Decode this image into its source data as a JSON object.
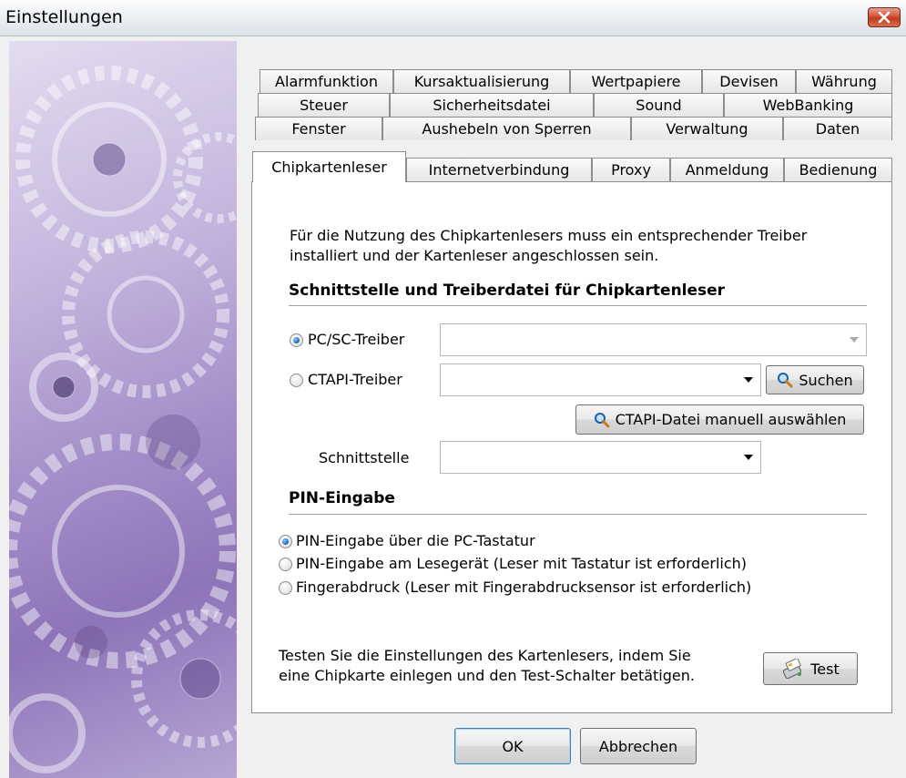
{
  "window": {
    "title": "Einstellungen"
  },
  "tabs": {
    "row1": [
      "Alarmfunktion",
      "Kursaktualisierung",
      "Wertpapiere",
      "Devisen",
      "Währung"
    ],
    "row2": [
      "Steuer",
      "Sicherheitsdatei",
      "Sound",
      "WebBanking"
    ],
    "row3": [
      "Fenster",
      "Aushebeln von Sperren",
      "Verwaltung",
      "Daten"
    ],
    "row4": [
      "Chipkartenleser",
      "Internetverbindung",
      "Proxy",
      "Anmeldung",
      "Bedienung"
    ],
    "active": "Chipkartenleser"
  },
  "panel": {
    "intro_line1": "Für die Nutzung des Chipkartenlesers muss ein entsprechender Treiber",
    "intro_line2": "installiert und der Kartenleser angeschlossen sein.",
    "section1_title": "Schnittstelle und Treiberdatei für Chipkartenleser",
    "pcsc_label": "PC/SC-Treiber",
    "ctapi_label": "CTAPI-Treiber",
    "search_button": "Suchen",
    "ctapi_manual_button": "CTAPI-Datei manuell auswählen",
    "interface_label": "Schnittstelle",
    "section2_title": "PIN-Eingabe",
    "pin_options": [
      "PIN-Eingabe über die PC-Tastatur",
      "PIN-Eingabe am Lesegerät (Leser mit Tastatur ist erforderlich)",
      "Fingerabdruck (Leser mit Fingerabdrucksensor ist erforderlich)"
    ],
    "test_line1": "Testen Sie die Einstellungen des Kartenlesers, indem Sie",
    "test_line2": "eine Chipkarte einlegen und den Test-Schalter betätigen.",
    "test_button": "Test"
  },
  "footer": {
    "ok_button": "OK",
    "cancel_button": "Abbrechen"
  },
  "icons": {
    "close": "close-icon",
    "search": "magnifier-icon",
    "test": "card-reader-icon"
  },
  "colors": {
    "accent_radio": "#1f6fc2",
    "close_button": "#c13a1e",
    "sidebar": "#a58fc9"
  }
}
